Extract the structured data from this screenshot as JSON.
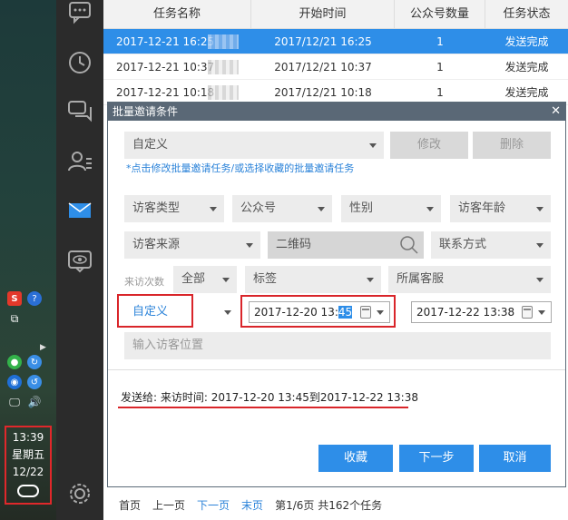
{
  "table": {
    "headers": [
      "任务名称",
      "开始时间",
      "公众号数量",
      "任务状态"
    ],
    "rows": [
      {
        "name": "2017-12-21 16:25",
        "start": "2017/12/21 16:25",
        "count": "1",
        "status": "发送完成"
      },
      {
        "name": "2017-12-21 10:37",
        "start": "2017/12/21 10:37",
        "count": "1",
        "status": "发送完成"
      },
      {
        "name": "2017-12-21 10:18",
        "start": "2017/12/21 10:18",
        "count": "1",
        "status": "发送完成"
      }
    ]
  },
  "dialog": {
    "title": "批量邀请条件",
    "close": "✕",
    "preset_select": "自定义",
    "modify_button": "修改",
    "delete_button": "删除",
    "hint": "*点击修改批量邀请任务/或选择收藏的批量邀请任务",
    "filters": {
      "visitor_type": "访客类型",
      "official_account": "公众号",
      "gender": "性别",
      "visitor_age": "访客年龄",
      "visitor_source": "访客来源",
      "qr_code_placeholder": "二维码",
      "contact": "联系方式",
      "visit_count_label": "来访次数",
      "visit_count": "全部",
      "tag": "标签",
      "assigned_service": "所属客服",
      "time_mode": "自定义",
      "start_datetime_pre": "2017-12-20 13:",
      "start_datetime_sel": "45",
      "end_datetime": "2017-12-22 13:38",
      "location_placeholder": "输入访客位置"
    },
    "send_to": "发送给: 来访时间: 2017-12-20 13:45到2017-12-22 13:38",
    "buttons": {
      "favorite": "收藏",
      "next": "下一步",
      "cancel": "取消"
    }
  },
  "pager": {
    "first": "首页",
    "prev": "上一页",
    "next": "下一页",
    "last": "末页",
    "info": "第1/6页 共162个任务"
  },
  "taskbar": {
    "time": "13:39",
    "weekday": "星期五",
    "date": "12/22",
    "sogou": "S",
    "help": "?"
  },
  "colors": {
    "accent": "#2e8ee8",
    "highlight_red": "#d9252a",
    "sidebar": "#2b2b2b"
  }
}
